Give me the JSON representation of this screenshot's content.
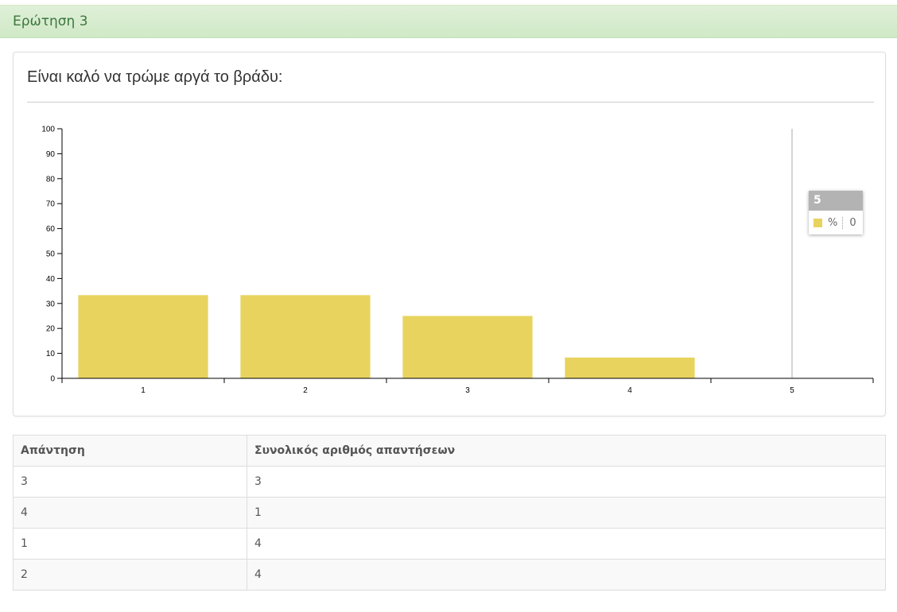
{
  "panel": {
    "heading": "Ερώτηση 3"
  },
  "question": {
    "title": "Είναι καλό να τρώμε αργά το βράδυ:"
  },
  "chart_data": {
    "type": "bar",
    "categories": [
      "1",
      "2",
      "3",
      "4",
      "5"
    ],
    "series": [
      {
        "name": "%",
        "values": [
          33.33,
          33.33,
          25,
          8.33,
          0
        ],
        "color": "#e8d35e"
      }
    ],
    "ylim": [
      0,
      100
    ],
    "yticks": [
      0,
      10,
      20,
      30,
      40,
      50,
      60,
      70,
      80,
      90,
      100
    ],
    "title": "",
    "xlabel": "",
    "ylabel": "",
    "grid": false,
    "legend": "none",
    "hover": {
      "category": "5",
      "series": "%",
      "value": "0"
    }
  },
  "tooltip": {
    "header": "5",
    "series": "%",
    "value": "0",
    "color": "#e8d35e"
  },
  "table": {
    "headers": [
      "Απάντηση",
      "Συνολικός αριθμός απαντήσεων"
    ],
    "rows": [
      [
        "3",
        "3"
      ],
      [
        "4",
        "1"
      ],
      [
        "1",
        "4"
      ],
      [
        "2",
        "4"
      ]
    ]
  }
}
